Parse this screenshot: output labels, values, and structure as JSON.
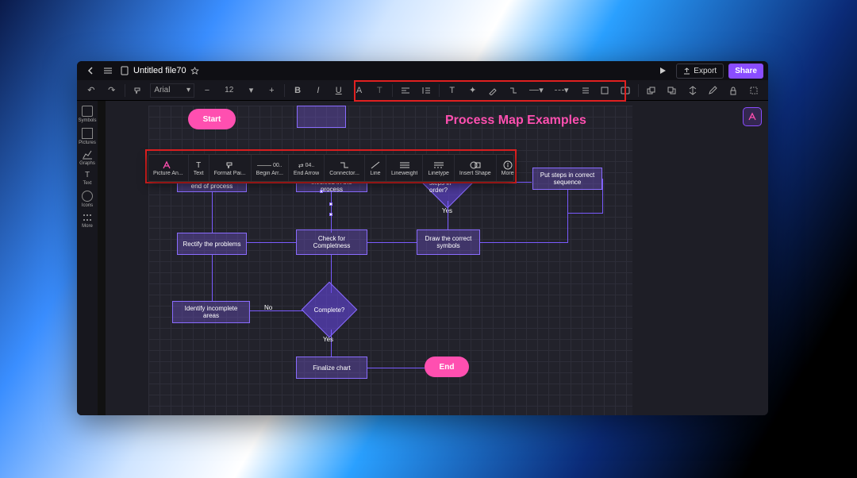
{
  "titlebar": {
    "filename": "Untitled file70",
    "export_label": "Export",
    "share_label": "Share"
  },
  "toolbar": {
    "font": "Arial",
    "size": "12"
  },
  "sidebar": {
    "s1": "Symbols",
    "s2": "Pictures",
    "s3": "Graphs",
    "s4": "Text",
    "s5": "Icons",
    "s6": "More"
  },
  "float": {
    "c1": "Picture An...",
    "c2": "Text",
    "c3": "Format Pai...",
    "c4": "Begin Arr...",
    "v4": "00..",
    "c5": "End Arrow",
    "v5": "04..",
    "c6": "Connector...",
    "c7": "Line",
    "c8": "Lineweight",
    "c9": "Linetype",
    "c10": "Insert Shape",
    "c11": "More"
  },
  "flow": {
    "title": "Process Map Examples",
    "start": "Start",
    "end": "End",
    "box_determine": "Determine start and end of process",
    "box_makelist": "Make a list of steps involved in the process",
    "box_putsteps": "Put steps in correct sequence",
    "diamond_order": "Are the steps in order?",
    "box_rectify": "Rectify the problems",
    "box_check": "Check for Completness",
    "box_draw": "Draw the correct symbols",
    "diamond_complete": "Complete?",
    "box_identify": "Identify incomplete areas",
    "box_finalize": "Finalize chart",
    "no1": "No",
    "yes1": "Yes",
    "no2": "No",
    "yes2": "Yes"
  }
}
